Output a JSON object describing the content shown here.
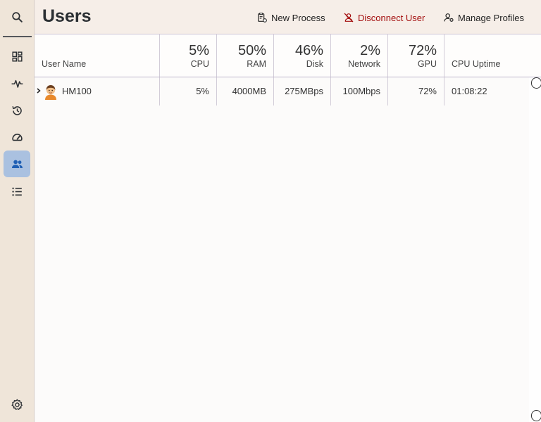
{
  "sidebar": {
    "items": [
      {
        "icon": "search-icon",
        "name": "sidebar-search"
      },
      {
        "icon": "dashboard-icon",
        "name": "sidebar-item-processes"
      },
      {
        "icon": "pulse-icon",
        "name": "sidebar-item-performance"
      },
      {
        "icon": "history-icon",
        "name": "sidebar-item-app-history"
      },
      {
        "icon": "speedometer-icon",
        "name": "sidebar-item-startup"
      },
      {
        "icon": "users-icon",
        "name": "sidebar-item-users",
        "active": true
      },
      {
        "icon": "list-icon",
        "name": "sidebar-item-details"
      }
    ],
    "settings_icon": "gear-icon"
  },
  "header": {
    "title": "Users",
    "new_process": "New Process",
    "disconnect_user": "Disconnect User",
    "manage_profiles": "Manage Profiles",
    "danger_color": "#a30d0d"
  },
  "table": {
    "columns": [
      {
        "key": "user",
        "label": "User Name"
      },
      {
        "key": "cpu",
        "percent": "5%",
        "label": "CPU"
      },
      {
        "key": "ram",
        "percent": "50%",
        "label": "RAM"
      },
      {
        "key": "disk",
        "percent": "46%",
        "label": "Disk"
      },
      {
        "key": "network",
        "percent": "2%",
        "label": "Network"
      },
      {
        "key": "gpu",
        "percent": "72%",
        "label": "GPU"
      },
      {
        "key": "uptime",
        "label": "CPU Uptime"
      }
    ],
    "rows": [
      {
        "avatar_icon": "person-emoji-icon",
        "user": "HM100",
        "cpu": "5%",
        "ram": "4000MB",
        "disk": "275MBps",
        "network": "100Mbps",
        "gpu": "72%",
        "uptime": "01:08:22"
      }
    ]
  },
  "colors": {
    "active_sidebar": "#aac1e0",
    "background": "#f0e6da"
  }
}
